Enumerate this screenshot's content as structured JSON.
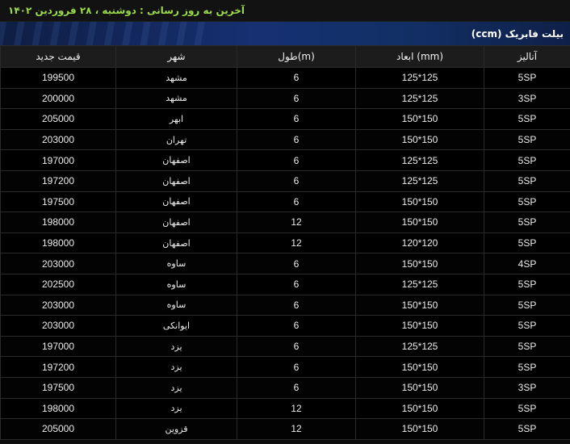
{
  "last_update": "آخرین به روز رسانی : دوشنبه ، ۲۸ فروردین ۱۴۰۲",
  "section_title": "بیلت فابریک (ccm)",
  "columns": {
    "analysis": "آنالیز",
    "dimensions": "ابعاد (mm)",
    "length": "طول(m)",
    "city": "شهر",
    "price": "قیمت جدید"
  },
  "rows": [
    {
      "analysis": "5SP",
      "dimensions": "125*125",
      "length": "6",
      "city": "مشهد",
      "price": "199500"
    },
    {
      "analysis": "3SP",
      "dimensions": "125*125",
      "length": "6",
      "city": "مشهد",
      "price": "200000"
    },
    {
      "analysis": "5SP",
      "dimensions": "150*150",
      "length": "6",
      "city": "ابهر",
      "price": "205000"
    },
    {
      "analysis": "5SP",
      "dimensions": "150*150",
      "length": "6",
      "city": "تهران",
      "price": "203000"
    },
    {
      "analysis": "5SP",
      "dimensions": "125*125",
      "length": "6",
      "city": "اصفهان",
      "price": "197000"
    },
    {
      "analysis": "5SP",
      "dimensions": "125*125",
      "length": "6",
      "city": "اصفهان",
      "price": "197200"
    },
    {
      "analysis": "5SP",
      "dimensions": "150*150",
      "length": "6",
      "city": "اصفهان",
      "price": "197500"
    },
    {
      "analysis": "5SP",
      "dimensions": "150*150",
      "length": "12",
      "city": "اصفهان",
      "price": "198000"
    },
    {
      "analysis": "5SP",
      "dimensions": "120*120",
      "length": "12",
      "city": "اصفهان",
      "price": "198000"
    },
    {
      "analysis": "4SP",
      "dimensions": "150*150",
      "length": "6",
      "city": "ساوه",
      "price": "203000"
    },
    {
      "analysis": "5SP",
      "dimensions": "125*125",
      "length": "6",
      "city": "ساوه",
      "price": "202500"
    },
    {
      "analysis": "5SP",
      "dimensions": "150*150",
      "length": "6",
      "city": "ساوه",
      "price": "203000"
    },
    {
      "analysis": "5SP",
      "dimensions": "150*150",
      "length": "6",
      "city": "ایوانکی",
      "price": "203000"
    },
    {
      "analysis": "5SP",
      "dimensions": "125*125",
      "length": "6",
      "city": "یزد",
      "price": "197000"
    },
    {
      "analysis": "5SP",
      "dimensions": "150*150",
      "length": "6",
      "city": "یزد",
      "price": "197200"
    },
    {
      "analysis": "3SP",
      "dimensions": "150*150",
      "length": "6",
      "city": "یزد",
      "price": "197500"
    },
    {
      "analysis": "5SP",
      "dimensions": "150*150",
      "length": "12",
      "city": "یزد",
      "price": "198000"
    },
    {
      "analysis": "5SP",
      "dimensions": "150*150",
      "length": "12",
      "city": "قزوین",
      "price": "205000"
    }
  ]
}
